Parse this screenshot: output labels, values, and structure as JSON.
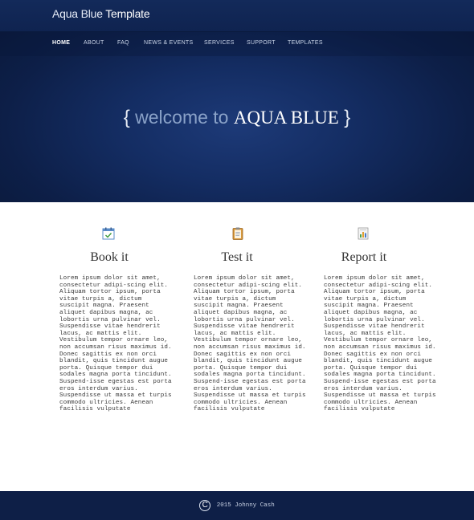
{
  "header": {
    "brand_part1": "Aqua Blue",
    "brand_part2": "Template"
  },
  "nav": {
    "items": [
      {
        "label": "HOME",
        "active": true
      },
      {
        "label": "ABOUT",
        "active": false
      },
      {
        "label": "FAQ",
        "active": false
      },
      {
        "label": "NEWS & EVENTS",
        "active": false
      },
      {
        "label": "SERVICES",
        "active": false
      },
      {
        "label": "SUPPORT",
        "active": false
      },
      {
        "label": "TEMPLATES",
        "active": false
      }
    ]
  },
  "hero": {
    "brace_open": "{",
    "lead": "welcome to",
    "name": "AQUA BLUE",
    "brace_close": "}"
  },
  "features": [
    {
      "icon": "calendar-icon",
      "title": "Book it",
      "text": "Lorem ipsum dolor sit amet, consectetur adipi-scing elit. Aliquam tortor ipsum, porta vitae turpis a, dictum suscipit magna. Praesent aliquet dapibus magna, ac lobortis urna pulvinar vel. Suspendisse vitae hendrerit lacus, ac mattis elit. Vestibulum tempor ornare leo, non accumsan risus maximus id. Donec sagittis ex non orci blandit, quis tincidunt augue porta. Quisque tempor dui sodales magna porta tincidunt. Suspend-isse egestas est porta eros interdum varius. Suspendisse ut massa et turpis commodo ultricies. Aenean facilisis vulputate"
    },
    {
      "icon": "clipboard-icon",
      "title": "Test it",
      "text": "Lorem ipsum dolor sit amet, consectetur adipi-scing elit. Aliquam tortor ipsum, porta vitae turpis a, dictum suscipit magna. Praesent aliquet dapibus magna, ac lobortis urna pulvinar vel. Suspendisse vitae hendrerit lacus, ac mattis elit. Vestibulum tempor ornare leo, non accumsan risus maximus id. Donec sagittis ex non orci blandit, quis tincidunt augue porta. Quisque tempor dui sodales magna porta tincidunt. Suspend-isse egestas est porta eros interdum varius. Suspendisse ut massa et turpis commodo ultricies. Aenean facilisis vulputate"
    },
    {
      "icon": "chart-report-icon",
      "title": "Report it",
      "text": "Lorem ipsum dolor sit amet, consectetur adipi-scing elit. Aliquam tortor ipsum, porta vitae turpis a, dictum suscipit magna. Praesent aliquet dapibus magna, ac lobortis urna pulvinar vel. Suspendisse vitae hendrerit lacus, ac mattis elit. Vestibulum tempor ornare leo, non accumsan risus maximus id. Donec sagittis ex non orci blandit, quis tincidunt augue porta. Quisque tempor dui sodales magna porta tincidunt. Suspend-isse egestas est porta eros interdum varius. Suspendisse ut massa et turpis commodo ultricies. Aenean facilisis vulputate"
    }
  ],
  "footer": {
    "copyright_symbol": "C",
    "text": "2015 Johnny Cash"
  },
  "colors": {
    "hero_dark": "#0a1838",
    "hero_light": "#1d3a78",
    "footer_bg": "#0e1f47",
    "body_text": "#3a3a3a"
  }
}
